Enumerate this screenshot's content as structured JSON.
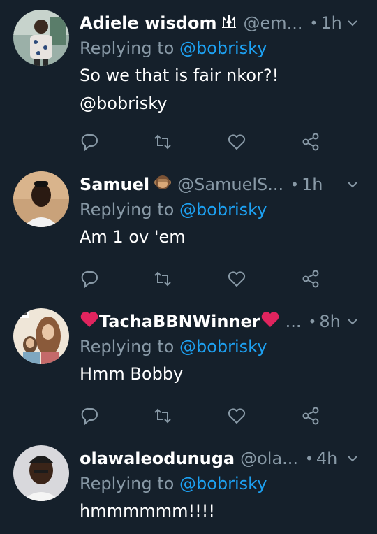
{
  "replying_label": "Replying to",
  "tweets": [
    {
      "name": "Adiele wisdom",
      "badge_icon": "trident-icon",
      "handle": "@em...",
      "dot": "•",
      "time": "1h",
      "mention": "@bobrisky",
      "text_lines": [
        "So we that is fair nkor?!",
        "@bobrisky"
      ]
    },
    {
      "name": "Samuel",
      "badge_icon": "monkey-emoji-icon",
      "handle": "@SamuelS...",
      "dot": "•",
      "time": "1h",
      "mention": "@bobrisky",
      "text_lines": [
        "Am 1 ov 'em"
      ]
    },
    {
      "name": "TachaBBNWinner",
      "badge_icon": "red-heart-icon",
      "handle": "...",
      "dot": "•",
      "time": "8h",
      "mention": "@bobrisky",
      "text_lines": [
        "Hmm Bobby"
      ]
    },
    {
      "name": "olawaleodunuga",
      "badge_icon": "",
      "handle": "@ola...",
      "dot": "•",
      "time": "4h",
      "mention": "@bobrisky",
      "text_lines": [
        "hmmmmmm!!!!"
      ]
    }
  ],
  "colors": {
    "background": "#15202b",
    "divider": "#38444d",
    "secondary_text": "#8899a6",
    "link": "#1da1f2",
    "heart": "#e0245e"
  },
  "action_icons": [
    "reply-icon",
    "retweet-icon",
    "like-icon",
    "share-icon"
  ]
}
